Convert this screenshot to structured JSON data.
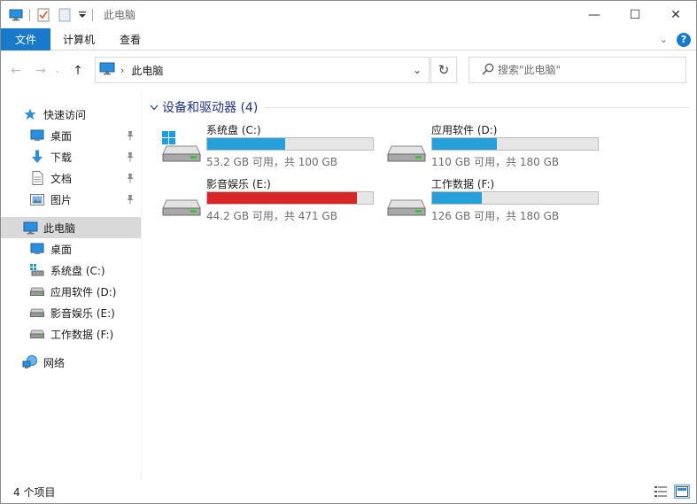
{
  "window": {
    "title": "此电脑",
    "controls": {
      "minimize": "—",
      "maximize": "☐",
      "close": "✕"
    }
  },
  "ribbon": {
    "tabs": [
      {
        "label": "文件",
        "active": true
      },
      {
        "label": "计算机"
      },
      {
        "label": "查看"
      }
    ]
  },
  "nav": {
    "back": "←",
    "forward": "→",
    "recent": "⌄",
    "up": "↑",
    "breadcrumb": [
      "此电脑"
    ],
    "refresh": "↻",
    "search_placeholder": "搜索\"此电脑\""
  },
  "sidebar": {
    "quick_access": {
      "label": "快速访问",
      "icon": "star-icon"
    },
    "quick_items": [
      {
        "label": "桌面",
        "icon": "desktop-icon",
        "pinned": true
      },
      {
        "label": "下载",
        "icon": "download-icon",
        "pinned": true
      },
      {
        "label": "文档",
        "icon": "document-icon",
        "pinned": true
      },
      {
        "label": "图片",
        "icon": "pictures-icon",
        "pinned": true
      }
    ],
    "this_pc": {
      "label": "此电脑",
      "icon": "computer-icon",
      "selected": true
    },
    "pc_items": [
      {
        "label": "桌面",
        "icon": "desktop-icon"
      },
      {
        "label": "系统盘 (C:)",
        "icon": "system-drive-icon"
      },
      {
        "label": "应用软件 (D:)",
        "icon": "drive-icon"
      },
      {
        "label": "影音娱乐 (E:)",
        "icon": "drive-icon"
      },
      {
        "label": "工作数据 (F:)",
        "icon": "drive-icon"
      }
    ],
    "network": {
      "label": "网络",
      "icon": "network-icon"
    }
  },
  "content": {
    "group_title": "设备和驱动器 (4)",
    "drives": [
      {
        "name": "系统盘 (C:)",
        "free_text": "53.2 GB 可用，共 100 GB",
        "used_fraction": 0.468,
        "nearly_full": false,
        "system": true
      },
      {
        "name": "应用软件 (D:)",
        "free_text": "110 GB 可用，共 180 GB",
        "used_fraction": 0.389,
        "nearly_full": false,
        "system": false
      },
      {
        "name": "影音娱乐 (E:)",
        "free_text": "44.2 GB 可用，共 471 GB",
        "used_fraction": 0.906,
        "nearly_full": true,
        "system": false
      },
      {
        "name": "工作数据 (F:)",
        "free_text": "126 GB 可用，共 180 GB",
        "used_fraction": 0.3,
        "nearly_full": false,
        "system": false
      }
    ]
  },
  "status": {
    "item_count": "4 个项目"
  },
  "colors": {
    "accent": "#1979ca",
    "bar_normal": "#26a0da",
    "bar_full": "#da2626",
    "group_title": "#1e3287"
  }
}
